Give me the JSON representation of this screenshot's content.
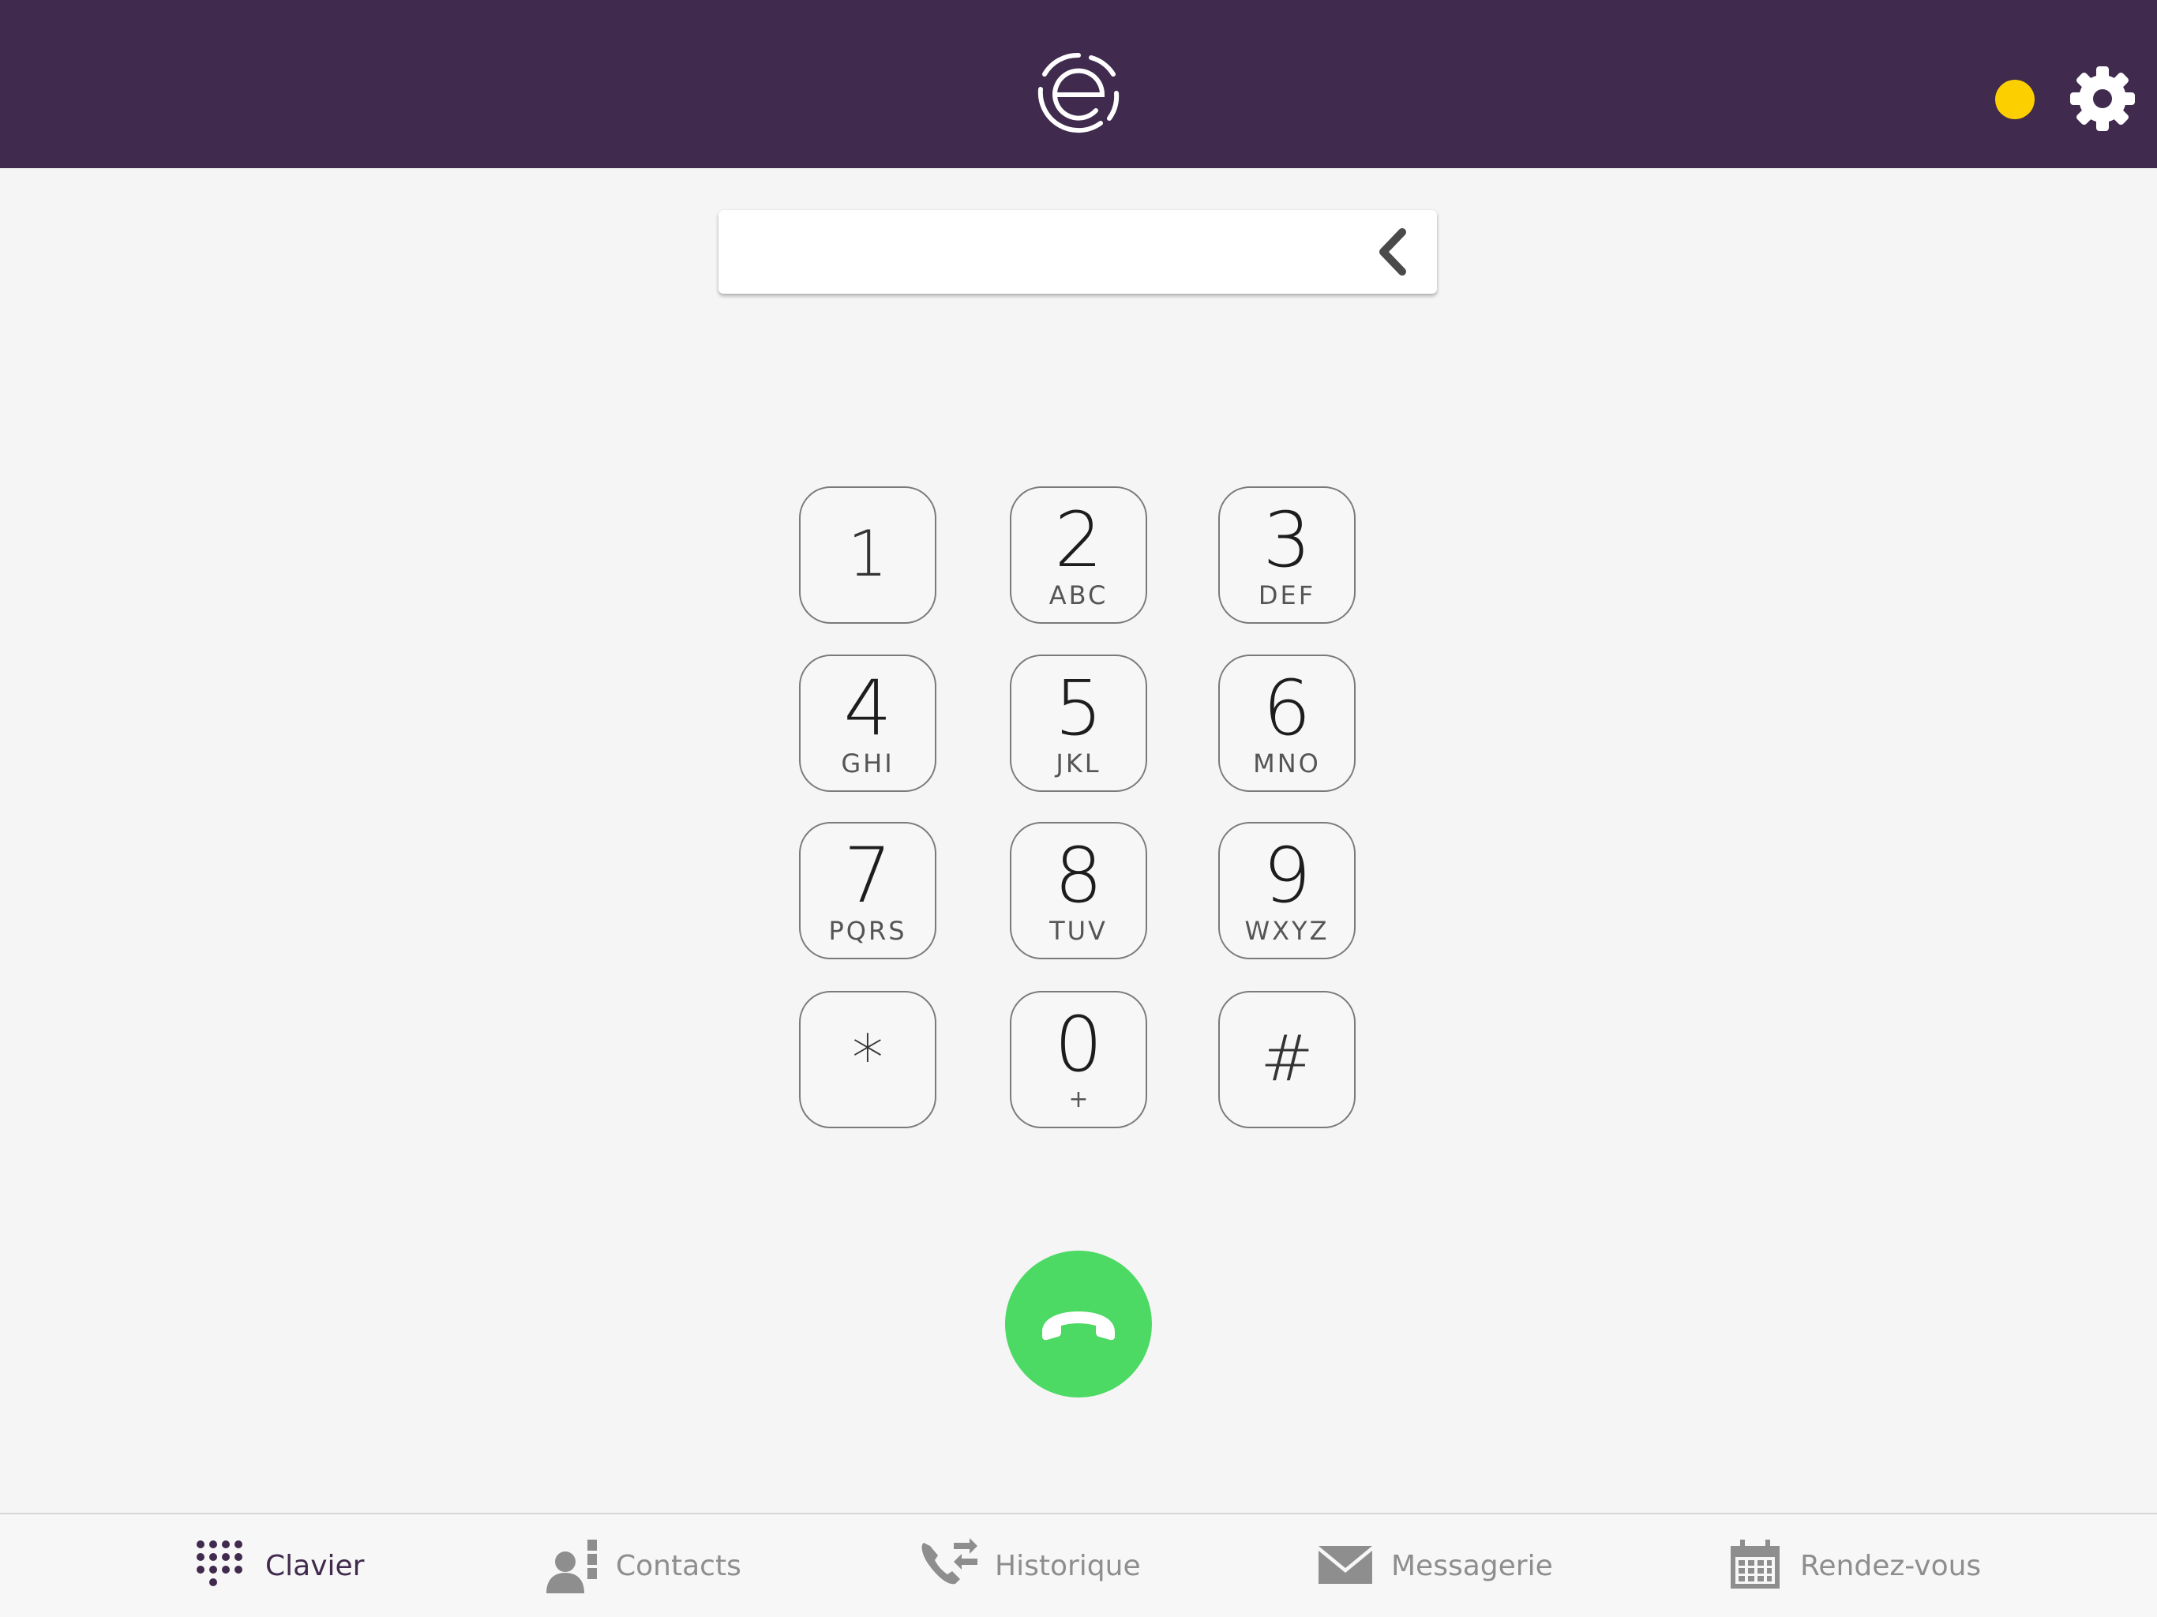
{
  "header": {
    "logo_icon": "e-logo-icon",
    "status_icon": "status-dot-icon",
    "status_color": "#fccf00",
    "settings_icon": "gear-icon",
    "background_color": "#402a4d"
  },
  "dialer": {
    "number_value": "",
    "backspace_icon": "chevron-left-icon"
  },
  "keypad": {
    "keys": [
      {
        "digit": "1",
        "letters": ""
      },
      {
        "digit": "2",
        "letters": "ABC"
      },
      {
        "digit": "3",
        "letters": "DEF"
      },
      {
        "digit": "4",
        "letters": "GHI"
      },
      {
        "digit": "5",
        "letters": "JKL"
      },
      {
        "digit": "6",
        "letters": "MNO"
      },
      {
        "digit": "7",
        "letters": "PQRS"
      },
      {
        "digit": "8",
        "letters": "TUV"
      },
      {
        "digit": "9",
        "letters": "WXYZ"
      },
      {
        "digit": "*",
        "letters": ""
      },
      {
        "digit": "0",
        "letters": "+"
      },
      {
        "digit": "#",
        "letters": ""
      }
    ]
  },
  "call": {
    "icon": "phone-handset-icon",
    "color": "#4cd964"
  },
  "tabs": [
    {
      "label": "Clavier",
      "icon": "keypad-dots-icon",
      "active": true
    },
    {
      "label": "Contacts",
      "icon": "contacts-icon",
      "active": false
    },
    {
      "label": "Historique",
      "icon": "call-history-icon",
      "active": false
    },
    {
      "label": "Messagerie",
      "icon": "envelope-icon",
      "active": false
    },
    {
      "label": "Rendez-vous",
      "icon": "calendar-icon",
      "active": false
    }
  ]
}
